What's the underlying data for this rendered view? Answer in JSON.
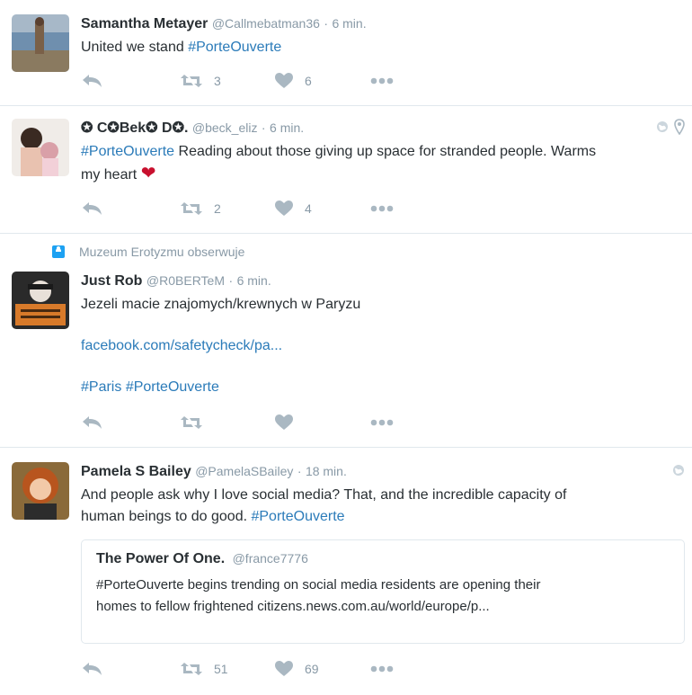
{
  "tweets": [
    {
      "name": "Samantha Metayer",
      "handle": "@Callmebatman36",
      "time": "6 min.",
      "text": "United we stand",
      "hashtag": "#PorteOuverte",
      "retweets": "3",
      "likes": "6"
    },
    {
      "name": "✪ C✪Bek✪ D✪.",
      "handle": "@beck_eliz",
      "time": "6 min.",
      "hashtag": "#PorteOuverte",
      "text1": "Reading about those giving up space for stranded people. Warms",
      "text2": "my heart",
      "heart": "❤",
      "retweets": "2",
      "likes": "4"
    },
    {
      "context": "Muzeum Erotyzmu obserwuje",
      "name": "Just Rob",
      "handle": "@R0BERTeM",
      "time": "6 min.",
      "text": "Jezeli macie znajomych/krewnych w Paryzu",
      "link": "facebook.com/safetycheck/pa...",
      "hashtag_paris": "#Paris",
      "hashtag": "#PorteOuverte",
      "retweets": "",
      "likes": ""
    },
    {
      "name": "Pamela S Bailey",
      "handle": "@PamelaSBailey",
      "time": "18 min.",
      "text1": "And people ask why I love social media? That, and the incredible capacity of",
      "text2": "human beings to do good.",
      "hashtag": "#PorteOuverte",
      "quote": {
        "name": "The Power Of One.",
        "handle": "@france7776",
        "text1": "#PorteOuverte begins trending on social media residents are opening their",
        "text2": "homes to fellow frightened citizens.news.com.au/world/europe/p..."
      },
      "retweets": "51",
      "likes": "69"
    }
  ],
  "separator": "·",
  "colors": {
    "link": "#2b7bb9",
    "muted": "#8899a6",
    "icon": "#aab8c2",
    "heart": "#e0245e"
  }
}
